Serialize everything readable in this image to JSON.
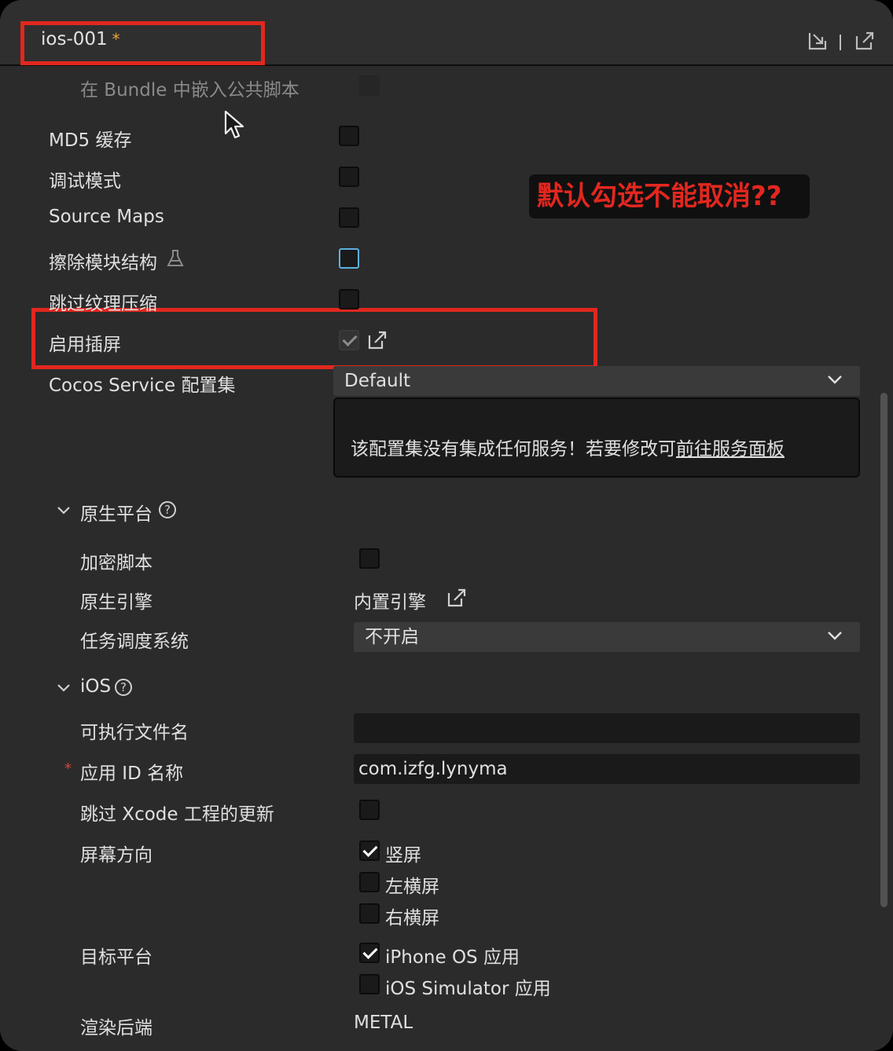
{
  "tab": {
    "title": "ios-001",
    "modified_mark": "*"
  },
  "annotation": "默认勾选不能取消??",
  "rows": {
    "embed_public_scripts": "在 Bundle 中嵌入公共脚本",
    "md5_cache": "MD5 缓存",
    "debug_mode": "调试模式",
    "source_maps": "Source Maps",
    "erase_module_structure": "擦除模块结构",
    "skip_texture_compression": "跳过纹理压缩",
    "enable_interstitial": "启用插屏",
    "cocos_service_config": "Cocos Service 配置集"
  },
  "service": {
    "selected": "Default",
    "message": "该配置集没有集成任何服务！若要修改可",
    "link": "前往服务面板"
  },
  "native_section": {
    "title": "原生平台",
    "encrypt_scripts": "加密脚本",
    "native_engine": "原生引擎",
    "native_engine_value": "内置引擎",
    "task_scheduler": "任务调度系统",
    "task_scheduler_value": "不开启"
  },
  "ios_section": {
    "title": "iOS",
    "executable_name": "可执行文件名",
    "executable_value": "",
    "app_id_label": "应用 ID 名称",
    "app_id_value": "com.izfg.lynyma",
    "skip_xcode_update": "跳过 Xcode 工程的更新",
    "orientation_label": "屏幕方向",
    "orientation_options": [
      "竖屏",
      "左横屏",
      "右横屏"
    ],
    "target_platform_label": "目标平台",
    "target_options": [
      "iPhone OS 应用",
      "iOS Simulator 应用"
    ],
    "render_backend_label": "渲染后端",
    "render_backend_value": "METAL"
  }
}
